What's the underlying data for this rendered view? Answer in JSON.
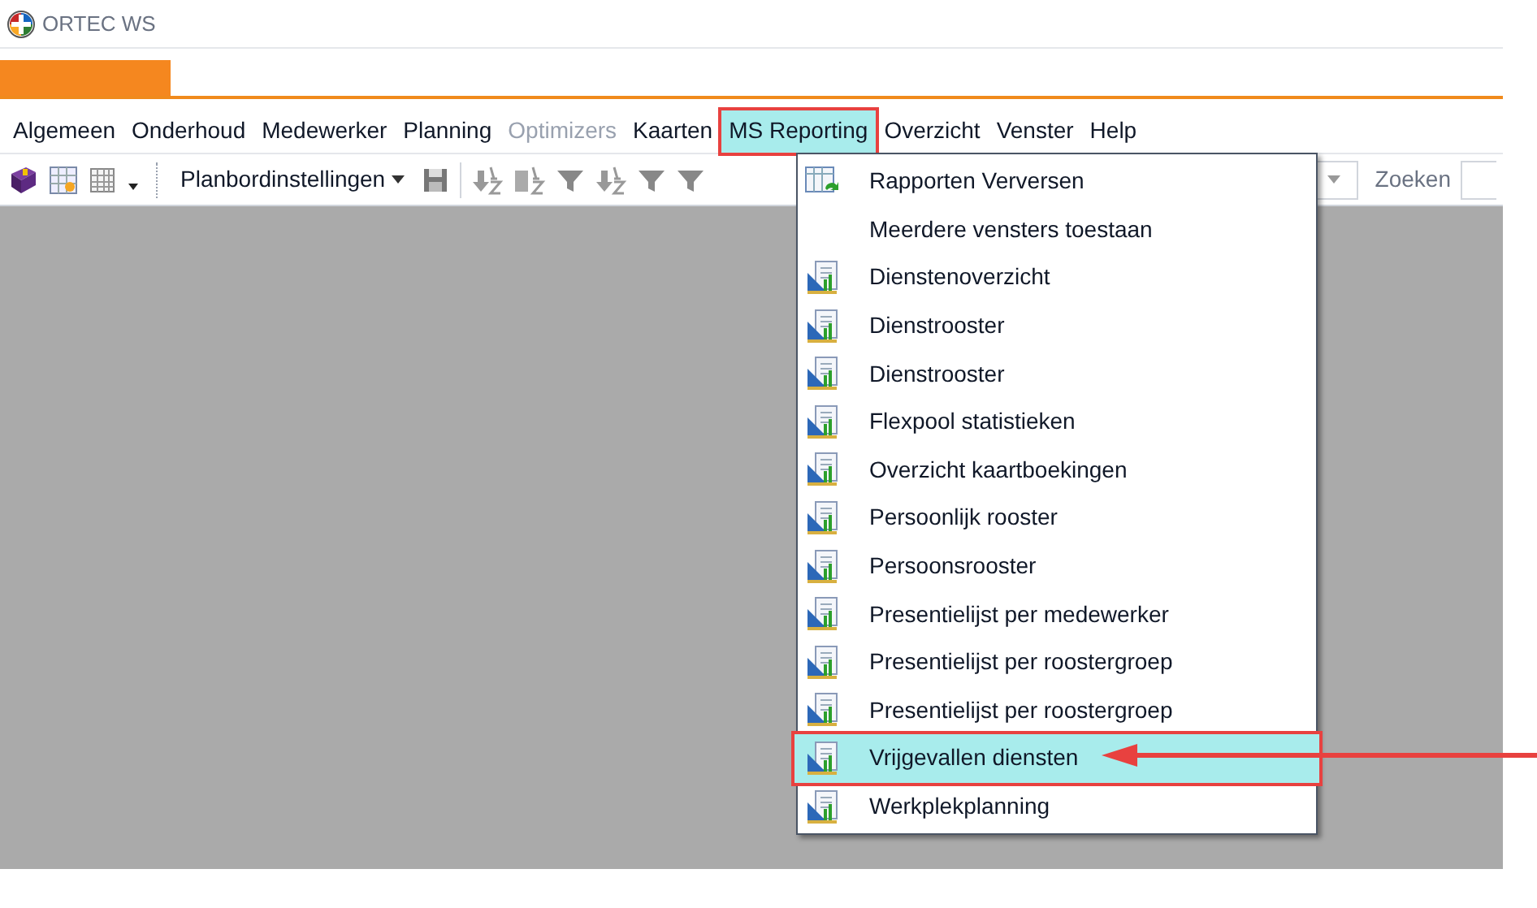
{
  "window": {
    "title": "ORTEC WS"
  },
  "menu_bar": [
    {
      "label": "Algemeen",
      "selected": false,
      "disabled": false
    },
    {
      "label": "Onderhoud",
      "selected": false,
      "disabled": false
    },
    {
      "label": "Medewerker",
      "selected": false,
      "disabled": false
    },
    {
      "label": "Planning",
      "selected": false,
      "disabled": false
    },
    {
      "label": "Optimizers",
      "selected": false,
      "disabled": true
    },
    {
      "label": "Kaarten",
      "selected": false,
      "disabled": false
    },
    {
      "label": "MS Reporting",
      "selected": true,
      "disabled": false
    },
    {
      "label": "Overzicht",
      "selected": false,
      "disabled": false
    },
    {
      "label": "Venster",
      "selected": false,
      "disabled": false
    },
    {
      "label": "Help",
      "selected": false,
      "disabled": false
    }
  ],
  "toolbar": {
    "settings_button": "Planbordinstellingen",
    "search_label": "Zoeken"
  },
  "dropdown_menu": [
    {
      "label": "Rapporten Verversen",
      "kind": "refresh",
      "selected": false
    },
    {
      "label": "Meerdere vensters toestaan",
      "kind": "plain",
      "selected": false
    },
    {
      "label": "Dienstenoverzicht",
      "kind": "report",
      "selected": false
    },
    {
      "label": "Dienstrooster",
      "kind": "report",
      "selected": false
    },
    {
      "label": "Dienstrooster",
      "kind": "report",
      "selected": false
    },
    {
      "label": "Flexpool statistieken",
      "kind": "report",
      "selected": false
    },
    {
      "label": "Overzicht kaartboekingen",
      "kind": "report",
      "selected": false
    },
    {
      "label": "Persoonlijk rooster",
      "kind": "report",
      "selected": false
    },
    {
      "label": "Persoonsrooster",
      "kind": "report",
      "selected": false
    },
    {
      "label": "Presentielijst per medewerker",
      "kind": "report",
      "selected": false
    },
    {
      "label": "Presentielijst per roostergroep",
      "kind": "report",
      "selected": false
    },
    {
      "label": "Presentielijst per roostergroep",
      "kind": "report",
      "selected": false
    },
    {
      "label": "Vrijgevallen diensten",
      "kind": "report",
      "selected": true
    },
    {
      "label": "Werkplekplanning",
      "kind": "report",
      "selected": false
    }
  ]
}
